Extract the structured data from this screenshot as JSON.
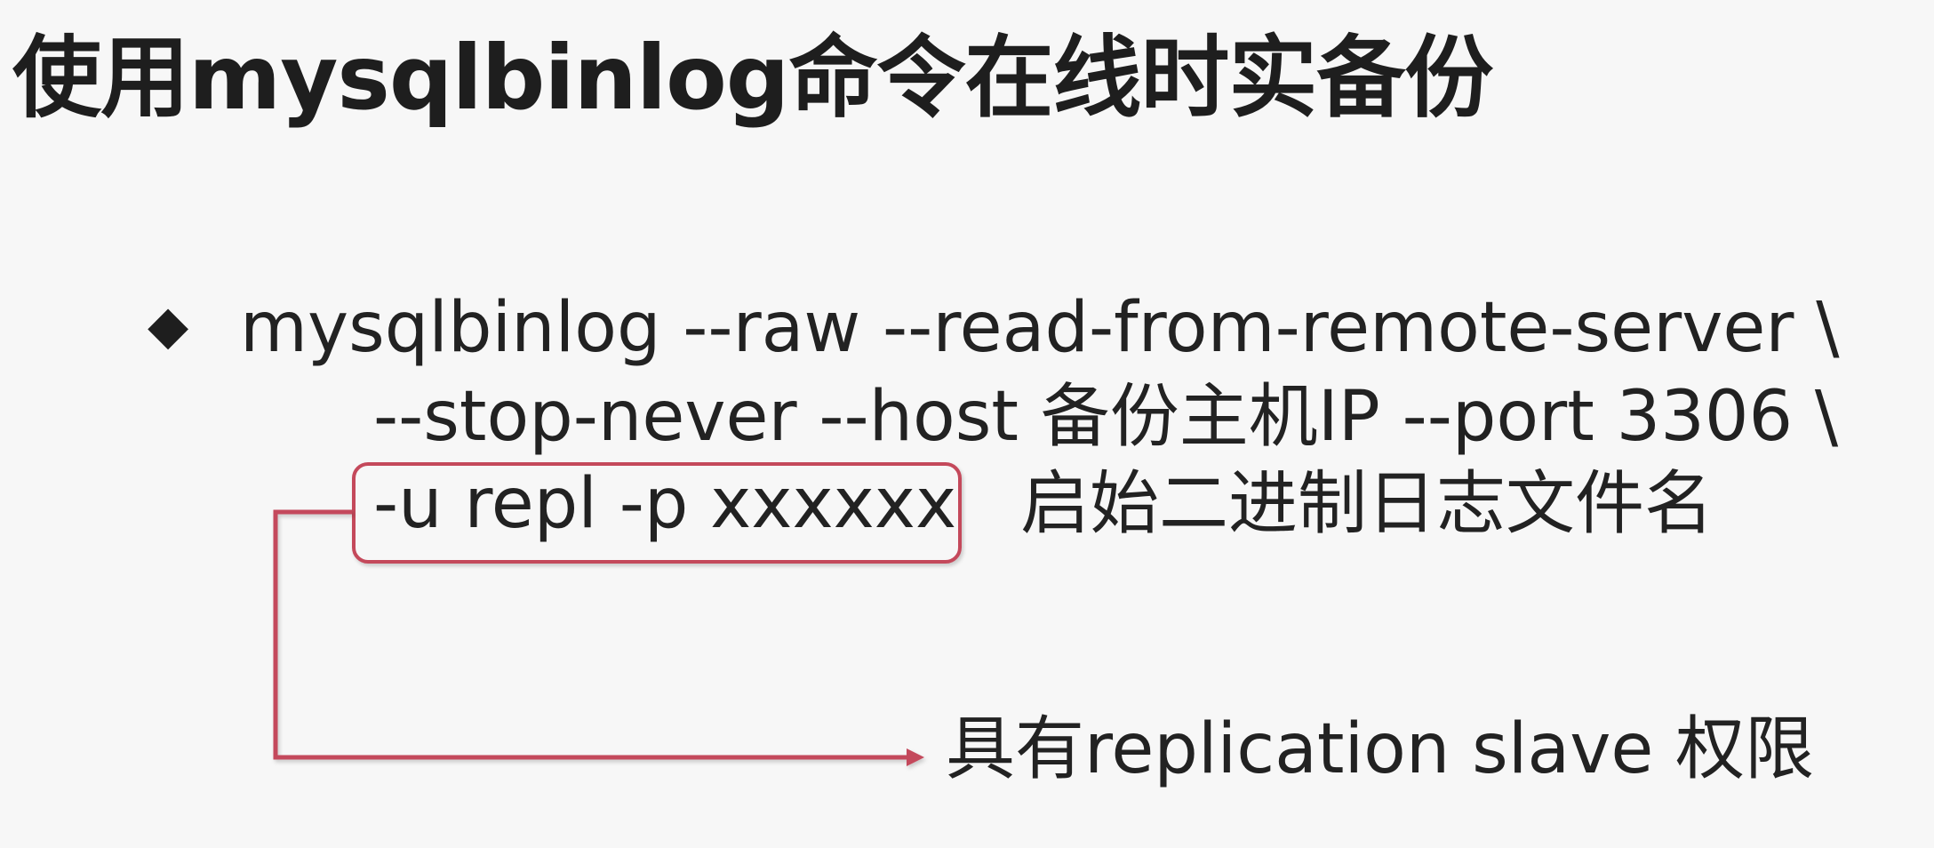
{
  "slide": {
    "title": "使用mysqlbinlog命令在线时实备份",
    "bullet_symbol": "◆",
    "command": {
      "line1": "mysqlbinlog --raw --read-from-remote-server \\",
      "line2": "--stop-never  --host 备份主机IP --port 3306 \\",
      "line3": "-u repl -p xxxxxx",
      "line3_note": "启始二进制日志文件名"
    },
    "annotation": "具有replication slave 权限"
  },
  "colors": {
    "background": "#f7f7f7",
    "text": "#1e1e1e",
    "highlight": "#c4495b"
  }
}
